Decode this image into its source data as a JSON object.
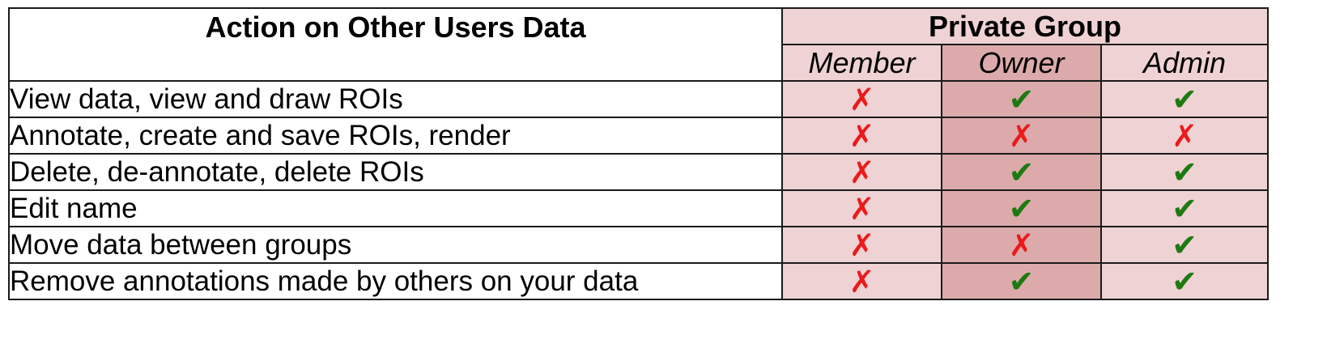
{
  "table": {
    "action_header": "Action on Other Users Data",
    "group_header": "Private Group",
    "roles": [
      "Member",
      "Owner",
      "Admin"
    ],
    "rows": [
      {
        "action": "View data, view and draw ROIs",
        "member": false,
        "owner": true,
        "admin": true
      },
      {
        "action": "Annotate, create and save ROIs, render",
        "member": false,
        "owner": false,
        "admin": false
      },
      {
        "action": "Delete, de-annotate, delete ROIs",
        "member": false,
        "owner": true,
        "admin": true
      },
      {
        "action": "Edit name",
        "member": false,
        "owner": true,
        "admin": true
      },
      {
        "action": "Move data between groups",
        "member": false,
        "owner": false,
        "admin": true
      },
      {
        "action": "Remove annotations made by others on your data",
        "member": false,
        "owner": true,
        "admin": true
      }
    ]
  },
  "marks": {
    "allowed_icon": "check-mark-icon",
    "denied_icon": "cross-mark-icon",
    "allowed_color": "#1d7a12",
    "denied_color": "#ea1b1b"
  },
  "colors": {
    "group_fill": "#eed2d4",
    "owner_fill": "#dcaaab"
  }
}
